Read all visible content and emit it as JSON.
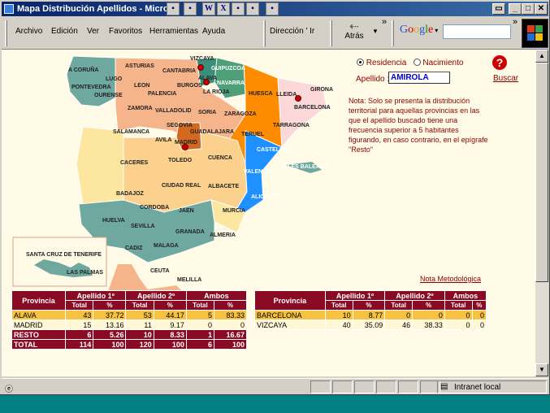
{
  "window": {
    "title": "Mapa Distribución Apellidos - Microso"
  },
  "menu": {
    "items": [
      "Archivo",
      "Edición",
      "Ver",
      "Favoritos",
      "Herramientas",
      "Ayuda"
    ],
    "address_label": "Dirección",
    "address_rest": "Ir",
    "back_label": "Atrás",
    "google_label": "Google"
  },
  "form": {
    "radio1": "Residencia",
    "radio2": "Nacimiento",
    "radio_selected": "Residencia",
    "apellido_label": "Apellido :",
    "apellido_value": "AMIROLA",
    "buscar": "Buscar"
  },
  "note": "Nota: Solo se presenta la distribución territorial para aquellas provincias en las que el apellido buscado tiene una frecuencia superior a 5 habitantes figurando, en caso contrario, en el epígrafe \"Resto\"",
  "nota_metodologica": "Nota Metodológica",
  "map": {
    "provinces": [
      "A CORUÑA",
      "LUGO",
      "PONTEVEDRA",
      "OURENSE",
      "ASTURIAS",
      "CANTABRIA",
      "VIZCAYA",
      "GUIPUZCOA",
      "ALAVA",
      "NAVARRA",
      "BURGOS",
      "LA RIOJA",
      "LEON",
      "PALENCIA",
      "HUESCA",
      "GIRONA",
      "LLEIDA",
      "BARCELONA",
      "ZAMORA",
      "VALLADOLID",
      "SORIA",
      "ZARAGOZA",
      "TARRAGONA",
      "SALAMANCA",
      "SEGOVIA",
      "GUADALAJARA",
      "TERUEL",
      "AVILA",
      "MADRID",
      "CASTELLON",
      "CACERES",
      "TOLEDO",
      "CUENCA",
      "VALENCIA",
      "ILLES BALEARS",
      "BADAJOZ",
      "CIUDAD REAL",
      "ALBACETE",
      "ALICANTE",
      "CORDOBA",
      "JAEN",
      "MURCIA",
      "HUELVA",
      "SEVILLA",
      "GRANADA",
      "ALMERIA",
      "CADIZ",
      "MALAGA",
      "SANTA CRUZ DE TENERIFE",
      "LAS PALMAS",
      "CEUTA",
      "MELILLA"
    ],
    "colors": {
      "dark_orange": "#ff8c00",
      "light_orange": "#f5b48a",
      "peach": "#fcd18e",
      "light_yellow": "#fde7a0",
      "teal": "#6fa89f",
      "blue": "#1e90ff",
      "pink": "#fcd8d8",
      "gray": "#c0c0c0"
    }
  },
  "table_left": {
    "headers": [
      "Provincia",
      "Apellido 1º",
      "Apellido 2º",
      "Ambos"
    ],
    "subheaders": [
      "Total",
      "%",
      "Total",
      "%",
      "Total",
      "%"
    ],
    "rows": [
      [
        "ALAVA",
        "43",
        "37.72",
        "53",
        "44.17",
        "5",
        "83.33"
      ],
      [
        "MADRID",
        "15",
        "13.16",
        "11",
        "9.17",
        "0",
        "0"
      ]
    ],
    "resto": [
      "RESTO",
      "6",
      "5.26",
      "10",
      "8.33",
      "1",
      "16.67"
    ],
    "total": [
      "TOTAL",
      "114",
      "100",
      "120",
      "100",
      "6",
      "100"
    ]
  },
  "table_right": {
    "headers": [
      "Provincia",
      "Apellido 1º",
      "Apellido 2º",
      "Ambos"
    ],
    "subheaders": [
      "Total",
      "%",
      "Total",
      "%",
      "Total",
      "%"
    ],
    "rows": [
      [
        "BARCELONA",
        "10",
        "8.77",
        "0",
        "0",
        "0",
        "0"
      ],
      [
        "VIZCAYA",
        "40",
        "35.09",
        "46",
        "38.33",
        "0",
        "0"
      ]
    ]
  },
  "status": {
    "left": "",
    "zone": "Intranet local"
  }
}
